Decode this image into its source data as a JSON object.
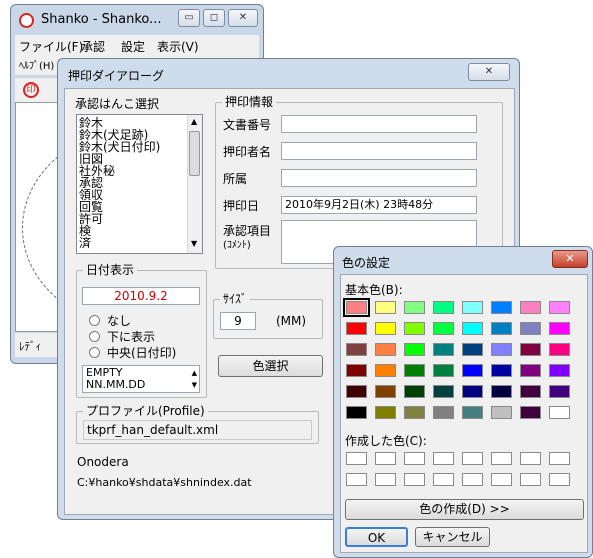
{
  "main_window": {
    "title": "Shanko - Shanko...",
    "menu": [
      "ファイル(F)",
      "承認",
      "設定",
      "表示(V)"
    ],
    "menu2": "ﾍﾙﾌﾟ(H)",
    "status": "ﾚﾃﾞｨ"
  },
  "dialog": {
    "title": "押印ダイアローグ",
    "stamp_select_label": "承認はんこ選択",
    "stamp_list": [
      "鈴木",
      "鈴木(犬足跡)",
      "鈴木(犬日付印)",
      "旧図",
      "社外秘",
      "承認",
      "領収",
      "回覧",
      "許可",
      "検",
      "済"
    ],
    "date_display": {
      "label": "日付表示",
      "value": "2010.9.2",
      "options": [
        "なし",
        "下に表示",
        "中央(日付印)"
      ],
      "formats": [
        "EMPTY",
        "NN.MM.DD"
      ]
    },
    "size": {
      "label": "ｻｲｽﾞ",
      "value": "9",
      "unit": "(MM)"
    },
    "color_button": "色選択",
    "info": {
      "label": "押印情報",
      "doc_no_label": "文書番号",
      "stamper_label": "押印者名",
      "dept_label": "所属",
      "date_label": "押印日",
      "date_value": "2010年9月2日(木) 23時48分",
      "comment_label": "承認項目",
      "comment_sub": "(ｺﾒﾝﾄ)"
    },
    "profile": {
      "label": "プロファイル(Profile)",
      "value": "tkprf_han_default.xml"
    },
    "user": "Onodera",
    "path": "C:¥hanko¥shdata¥shnindex.dat"
  },
  "color_dialog": {
    "title": "色の設定",
    "basic_label": "基本色(B):",
    "basic_colors": [
      "#ff8080",
      "#ffff80",
      "#80ff80",
      "#00ff80",
      "#80ffff",
      "#0080ff",
      "#ff80c0",
      "#ff80ff",
      "#ff0000",
      "#ffff00",
      "#80ff00",
      "#00ff40",
      "#00ffff",
      "#0080c0",
      "#8080c0",
      "#ff00ff",
      "#804040",
      "#ff8040",
      "#00ff00",
      "#008080",
      "#004080",
      "#8080ff",
      "#800040",
      "#ff0080",
      "#800000",
      "#ff8000",
      "#008000",
      "#008040",
      "#0000ff",
      "#0000a0",
      "#800080",
      "#8000ff",
      "#400000",
      "#804000",
      "#004000",
      "#004040",
      "#000080",
      "#000040",
      "#400040",
      "#400080",
      "#000000",
      "#808000",
      "#808040",
      "#808080",
      "#408080",
      "#c0c0c0",
      "#400040",
      "#ffffff"
    ],
    "custom_label": "作成した色(C):",
    "define_button": "色の作成(D) >>",
    "ok_button": "OK",
    "cancel_button": "キャンセル"
  }
}
